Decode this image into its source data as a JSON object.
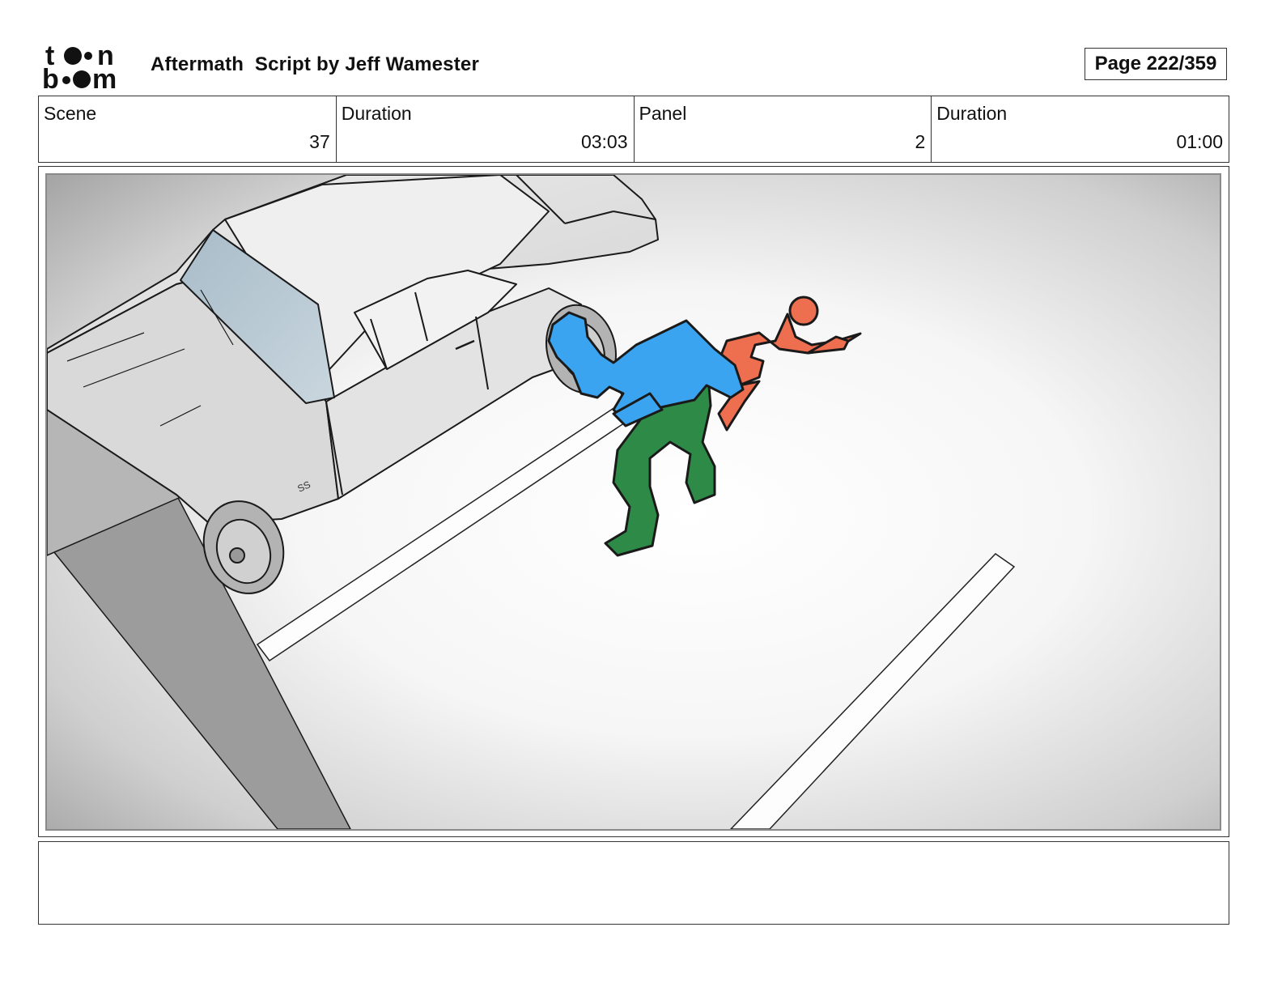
{
  "header": {
    "logo_alt": "toon boom",
    "title": "Aftermath  Script by Jeff Wamester",
    "page_label": "Page 222/359"
  },
  "info": {
    "scene_label": "Scene",
    "scene_value": "37",
    "scene_duration_label": "Duration",
    "scene_duration_value": "03:03",
    "panel_label": "Panel",
    "panel_value": "2",
    "panel_duration_label": "Duration",
    "panel_duration_value": "01:00"
  },
  "panel": {
    "description": "",
    "colors": {
      "blue_figure": "#3aa4f0",
      "green_figure": "#2e8b47",
      "red_figure": "#ee6e50",
      "line": "#1a1a1a"
    }
  },
  "notes": {
    "text": ""
  }
}
